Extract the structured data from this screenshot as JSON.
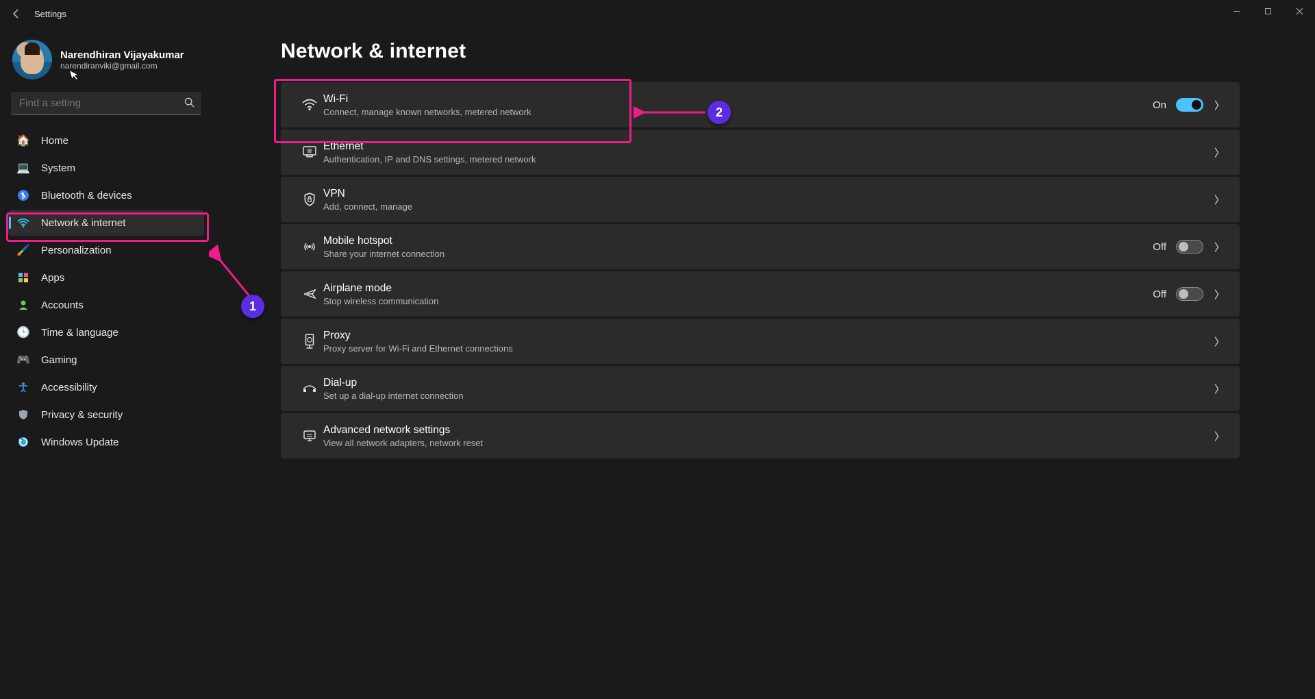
{
  "window": {
    "title": "Settings"
  },
  "user": {
    "name": "Narendhiran Vijayakumar",
    "email": "narendiranviki@gmail.com"
  },
  "search": {
    "placeholder": "Find a setting"
  },
  "nav": {
    "items": [
      {
        "label": "Home"
      },
      {
        "label": "System"
      },
      {
        "label": "Bluetooth & devices"
      },
      {
        "label": "Network & internet"
      },
      {
        "label": "Personalization"
      },
      {
        "label": "Apps"
      },
      {
        "label": "Accounts"
      },
      {
        "label": "Time & language"
      },
      {
        "label": "Gaming"
      },
      {
        "label": "Accessibility"
      },
      {
        "label": "Privacy & security"
      },
      {
        "label": "Windows Update"
      }
    ]
  },
  "page": {
    "title": "Network & internet"
  },
  "rows": {
    "wifi": {
      "title": "Wi-Fi",
      "sub": "Connect, manage known networks, metered network",
      "state": "On"
    },
    "ethernet": {
      "title": "Ethernet",
      "sub": "Authentication, IP and DNS settings, metered network"
    },
    "vpn": {
      "title": "VPN",
      "sub": "Add, connect, manage"
    },
    "hotspot": {
      "title": "Mobile hotspot",
      "sub": "Share your internet connection",
      "state": "Off"
    },
    "airplane": {
      "title": "Airplane mode",
      "sub": "Stop wireless communication",
      "state": "Off"
    },
    "proxy": {
      "title": "Proxy",
      "sub": "Proxy server for Wi-Fi and Ethernet connections"
    },
    "dialup": {
      "title": "Dial-up",
      "sub": "Set up a dial-up internet connection"
    },
    "advanced": {
      "title": "Advanced network settings",
      "sub": "View all network adapters, network reset"
    }
  },
  "annotations": {
    "step1": "1",
    "step2": "2"
  }
}
